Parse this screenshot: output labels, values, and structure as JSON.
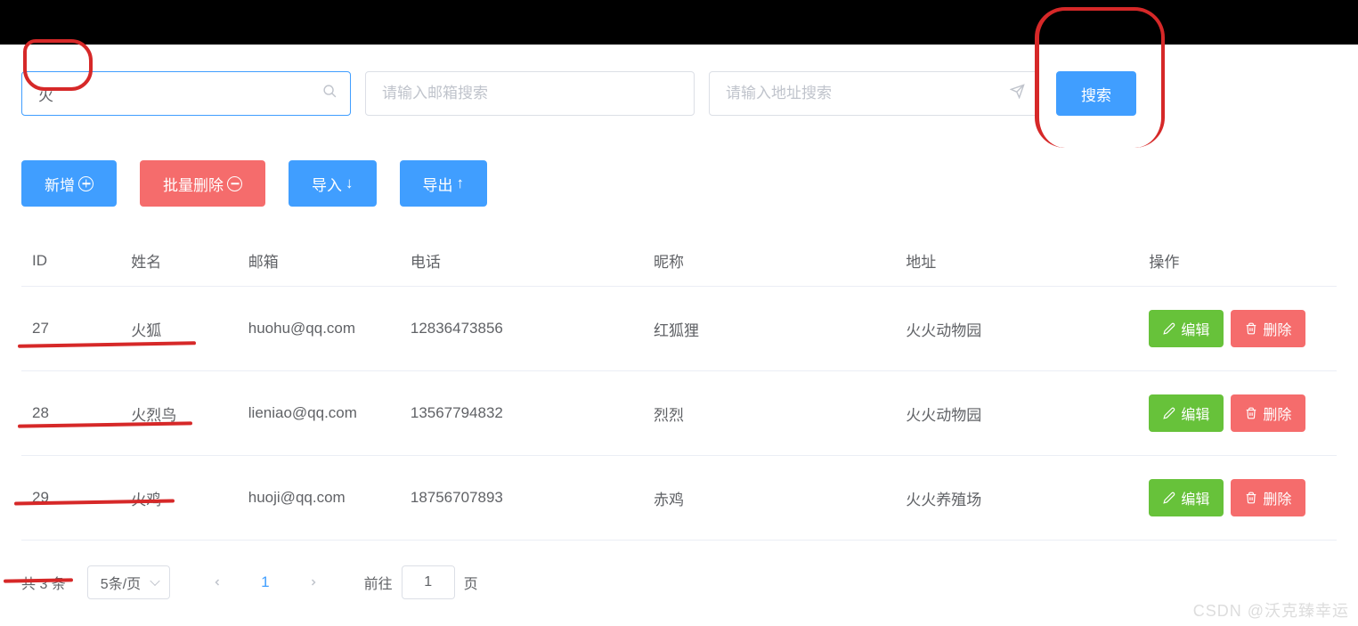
{
  "search": {
    "name_value": "火",
    "email_placeholder": "请输入邮箱搜索",
    "address_placeholder": "请输入地址搜索",
    "button_label": "搜索"
  },
  "actions": {
    "add": "新增",
    "batch_delete": "批量删除",
    "import": "导入",
    "export": "导出"
  },
  "table": {
    "headers": {
      "id": "ID",
      "name": "姓名",
      "email": "邮箱",
      "phone": "电话",
      "nickname": "昵称",
      "address": "地址",
      "ops": "操作"
    },
    "rows": [
      {
        "id": "27",
        "name": "火狐",
        "email": "huohu@qq.com",
        "phone": "12836473856",
        "nickname": "红狐狸",
        "address": "火火动物园"
      },
      {
        "id": "28",
        "name": "火烈鸟",
        "email": "lieniao@qq.com",
        "phone": "13567794832",
        "nickname": "烈烈",
        "address": "火火动物园"
      },
      {
        "id": "29",
        "name": "火鸡",
        "email": "huoji@qq.com",
        "phone": "18756707893",
        "nickname": "赤鸡",
        "address": "火火养殖场"
      }
    ],
    "row_buttons": {
      "edit": "编辑",
      "delete": "删除"
    }
  },
  "pagination": {
    "total_text": "共 3 条",
    "page_size_label": "5条/页",
    "current_page": "1",
    "jumper_prefix": "前往",
    "jumper_page_value": "1",
    "jumper_suffix": "页"
  },
  "watermark": "CSDN @沃克臻幸运"
}
